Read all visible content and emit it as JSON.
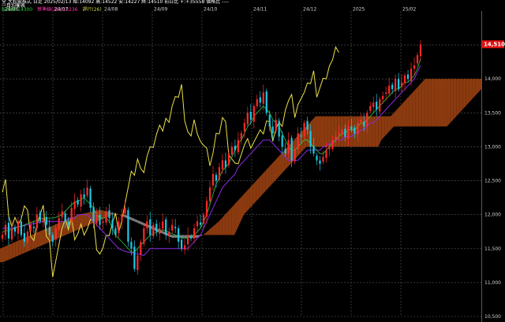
{
  "header": {
    "line1": "全 大和電株式 日足 2025/02/13 始:14092 高:14522 安:14227 終:14510 前日比 +:+35558 価格比 ----",
    "line2": "一目均衡表",
    "line3": [
      {
        "text": "転換線:14300",
        "color": "#2ecc40"
      },
      {
        "text": "基準線(26):13236",
        "color": "#ff33aa"
      },
      {
        "text": "遅行(26)",
        "color": "#cccc44"
      }
    ]
  },
  "price_tag": "14,510",
  "colors": {
    "up": "#ff2a2a",
    "down": "#1cc9e8",
    "tenkan": "#2ecc40",
    "kijun": "#8a2be2",
    "chikou": "#e8e04a",
    "cloud_bull": "#8b3a0f",
    "cloud_bear": "#7a7a7a",
    "grid": "#5a5a5a",
    "axis_text": "#cfcfcf"
  },
  "chart_data": {
    "type": "candlestick",
    "title": "",
    "x_ticks": [
      "24/06",
      "24/07",
      "24/08",
      "24/09",
      "24/10",
      "24/11",
      "24/12",
      "2025",
      "25/02"
    ],
    "y_ticks": [
      14500,
      14000,
      13500,
      13000,
      12500,
      12000,
      11500,
      11000,
      10500
    ],
    "y_tick_labels": [
      "14,500",
      "14,000",
      "13,500",
      "13,000",
      "12,500",
      "12,000",
      "11,500",
      "11,000",
      "10,500"
    ],
    "ylim": [
      10500,
      15000
    ],
    "grid": true,
    "last_close": 14510,
    "closes": [
      11700,
      11850,
      11650,
      11800,
      11750,
      11900,
      11700,
      11600,
      11750,
      11850,
      11800,
      12000,
      11900,
      11950,
      11850,
      11700,
      11600,
      11800,
      11950,
      12050,
      11900,
      11850,
      12100,
      12200,
      12150,
      12300,
      12250,
      12400,
      12100,
      11900,
      12000,
      11850,
      11900,
      12050,
      11950,
      11800,
      11700,
      11900,
      12000,
      12100,
      11600,
      11500,
      11200,
      11400,
      11600,
      11800,
      11900,
      11700,
      11850,
      11750,
      11800,
      11900,
      11700,
      11750,
      11850,
      11800,
      11600,
      11500,
      11550,
      11700,
      11650,
      11800,
      11900,
      11850,
      12000,
      12200,
      12400,
      12600,
      12500,
      12700,
      12800,
      12700,
      12900,
      13000,
      12950,
      13100,
      13200,
      13350,
      13500,
      13400,
      13600,
      13700,
      13650,
      13800,
      13500,
      13300,
      13200,
      13400,
      13150,
      13000,
      12900,
      13100,
      12800,
      12950,
      13200,
      13150,
      13350,
      13250,
      13000,
      12900,
      12800,
      12750,
      12850,
      12950,
      13000,
      13100,
      13150,
      13200,
      13250,
      13150,
      13300,
      13250,
      13200,
      13350,
      13400,
      13300,
      13500,
      13600,
      13650,
      13550,
      13700,
      13750,
      13800,
      13900,
      13850,
      14000,
      13850,
      13950,
      14050,
      14000,
      14150,
      14200,
      14350,
      14510
    ],
    "tenkan": [
      11750,
      11760,
      11770,
      11780,
      11800,
      11820,
      11830,
      11850,
      11870,
      11880,
      11900,
      11920,
      11940,
      11950,
      11950,
      11950,
      11950,
      11960,
      11980,
      12000,
      12050,
      12100,
      12150,
      12180,
      12200,
      12220,
      12250,
      12200,
      12150,
      12100,
      12000,
      11950,
      11950,
      11950,
      11900,
      11800,
      11700,
      11650,
      11600,
      11550,
      11500,
      11450,
      11450,
      11500,
      11550,
      11600,
      11650,
      11700,
      11720,
      11740,
      11760,
      11780,
      11760,
      11740,
      11720,
      11700,
      11680,
      11660,
      11650,
      11660,
      11680,
      11700,
      11750,
      11800,
      11900,
      12000,
      12150,
      12300,
      12450,
      12550,
      12650,
      12700,
      12750,
      12850,
      12950,
      13050,
      13100,
      13200,
      13300,
      13350,
      13450,
      13500,
      13550,
      13600,
      13550,
      13500,
      13400,
      13350,
      13300,
      13200,
      13100,
      13000,
      12950,
      12950,
      13000,
      13050,
      13100,
      13100,
      13050,
      13000,
      12950,
      12900,
      12900,
      12950,
      13000,
      13050,
      13100,
      13150,
      13200,
      13200,
      13250,
      13250,
      13250,
      13300,
      13350,
      13350,
      13400,
      13450,
      13500,
      13550,
      13600,
      13650,
      13700,
      13750,
      13800,
      13850,
      13850,
      13900,
      13950,
      13950,
      14000,
      14050,
      14150,
      14300
    ],
    "kijun": [
      11800,
      11800,
      11800,
      11800,
      11810,
      11820,
      11830,
      11840,
      11850,
      11860,
      11870,
      11880,
      11890,
      11900,
      11900,
      11900,
      11900,
      11900,
      11900,
      11900,
      11900,
      11950,
      11950,
      11950,
      12000,
      12000,
      12000,
      12000,
      11950,
      11900,
      11850,
      11800,
      11750,
      11700,
      11650,
      11600,
      11550,
      11500,
      11480,
      11460,
      11450,
      11440,
      11430,
      11420,
      11410,
      11400,
      11450,
      11500,
      11500,
      11500,
      11500,
      11500,
      11500,
      11500,
      11500,
      11500,
      11500,
      11500,
      11500,
      11500,
      11550,
      11600,
      11650,
      11700,
      11800,
      11900,
      12000,
      12100,
      12200,
      12300,
      12400,
      12450,
      12500,
      12550,
      12600,
      12700,
      12750,
      12800,
      12850,
      12900,
      12950,
      13000,
      13050,
      13100,
      13100,
      13100,
      13050,
      13000,
      12950,
      12900,
      12850,
      12800,
      12800,
      12800,
      12800,
      12850,
      12900,
      12950,
      12950,
      12950,
      12950,
      12950,
      13000,
      13000,
      13050,
      13050,
      13100,
      13100,
      13100,
      13150,
      13150,
      13150,
      13200,
      13200,
      13250,
      13250,
      13300,
      13350,
      13350,
      13400,
      13450,
      13500,
      13550,
      13600,
      13650,
      13700,
      13750,
      13800,
      13850,
      13900,
      13950,
      14000,
      14100,
      14200
    ],
    "span_a": [
      11500,
      11520,
      11540,
      11560,
      11580,
      11600,
      11620,
      11640,
      11660,
      11680,
      11700,
      11720,
      11740,
      11760,
      11780,
      11800,
      11820,
      11840,
      11860,
      11880,
      11900,
      11920,
      11940,
      11960,
      11980,
      12000,
      12010,
      12020,
      12030,
      12040,
      12050,
      12060,
      12070,
      12060,
      12050,
      12040,
      12030,
      12020,
      12000,
      11980,
      11960,
      11940,
      11920,
      11900,
      11880,
      11860,
      11840,
      11820,
      11800,
      11780,
      11760,
      11740,
      11720,
      11700,
      11680,
      11660,
      11660,
      11660,
      11660,
      11660,
      11660,
      11660,
      11660,
      11660,
      11680,
      11700,
      11740,
      11780,
      11820,
      11860,
      11900,
      11950,
      12000,
      12050,
      12100,
      12150,
      12200,
      12250,
      12300,
      12350,
      12400,
      12450,
      12500,
      12550,
      12600,
      12650,
      12700,
      12750,
      12800,
      12850,
      12900,
      12950,
      13000,
      13050,
      13100,
      13150,
      13200,
      13250,
      13300,
      13350,
      13400,
      13450,
      13450,
      13450,
      13450,
      13450,
      13450,
      13450,
      13450,
      13450,
      13450,
      13450,
      13450,
      13450,
      13450,
      13450,
      13450,
      13450,
      13450,
      13450,
      13450,
      13450,
      13450,
      13450,
      13450,
      13450,
      13500,
      13550,
      13600,
      13650,
      13700,
      13750,
      13800,
      13850,
      13900,
      13950,
      14000,
      14000,
      14000,
      14000,
      14000,
      14000,
      14000,
      14000,
      14000,
      14000,
      14000,
      14000,
      14000,
      14000,
      14000,
      14000,
      14000,
      14000,
      14000
    ],
    "span_b": [
      11300,
      11300,
      11320,
      11340,
      11360,
      11380,
      11400,
      11420,
      11440,
      11460,
      11480,
      11500,
      11520,
      11540,
      11560,
      11580,
      11600,
      11620,
      11640,
      11660,
      11680,
      11700,
      11720,
      11740,
      11760,
      11780,
      11800,
      11820,
      11840,
      11860,
      11880,
      11900,
      11920,
      11940,
      11960,
      11980,
      12000,
      12000,
      12000,
      12000,
      12000,
      11980,
      11960,
      11940,
      11920,
      11900,
      11880,
      11860,
      11840,
      11820,
      11800,
      11780,
      11760,
      11740,
      11720,
      11700,
      11700,
      11700,
      11700,
      11700,
      11700,
      11700,
      11700,
      11700,
      11700,
      11700,
      11700,
      11700,
      11700,
      11700,
      11700,
      11700,
      11700,
      11700,
      11700,
      11700,
      11800,
      11900,
      12000,
      12050,
      12100,
      12150,
      12200,
      12250,
      12300,
      12350,
      12400,
      12450,
      12500,
      12550,
      12600,
      12650,
      12700,
      12750,
      12800,
      12850,
      12900,
      12950,
      13000,
      13000,
      13000,
      13000,
      13000,
      13000,
      13000,
      13000,
      13000,
      13000,
      13000,
      13000,
      13000,
      13000,
      13000,
      13000,
      13000,
      13000,
      13000,
      13000,
      13000,
      13000,
      13000,
      13000,
      13100,
      13150,
      13200,
      13250,
      13300,
      13300,
      13300,
      13300,
      13300,
      13300,
      13300,
      13300,
      13300,
      13300,
      13300,
      13300,
      13300,
      13300,
      13300,
      13300,
      13300,
      13300,
      13350,
      13400,
      13450,
      13500,
      13550,
      13600,
      13650,
      13700,
      13750,
      13800,
      13850,
      13900,
      13950,
      14000
    ]
  }
}
